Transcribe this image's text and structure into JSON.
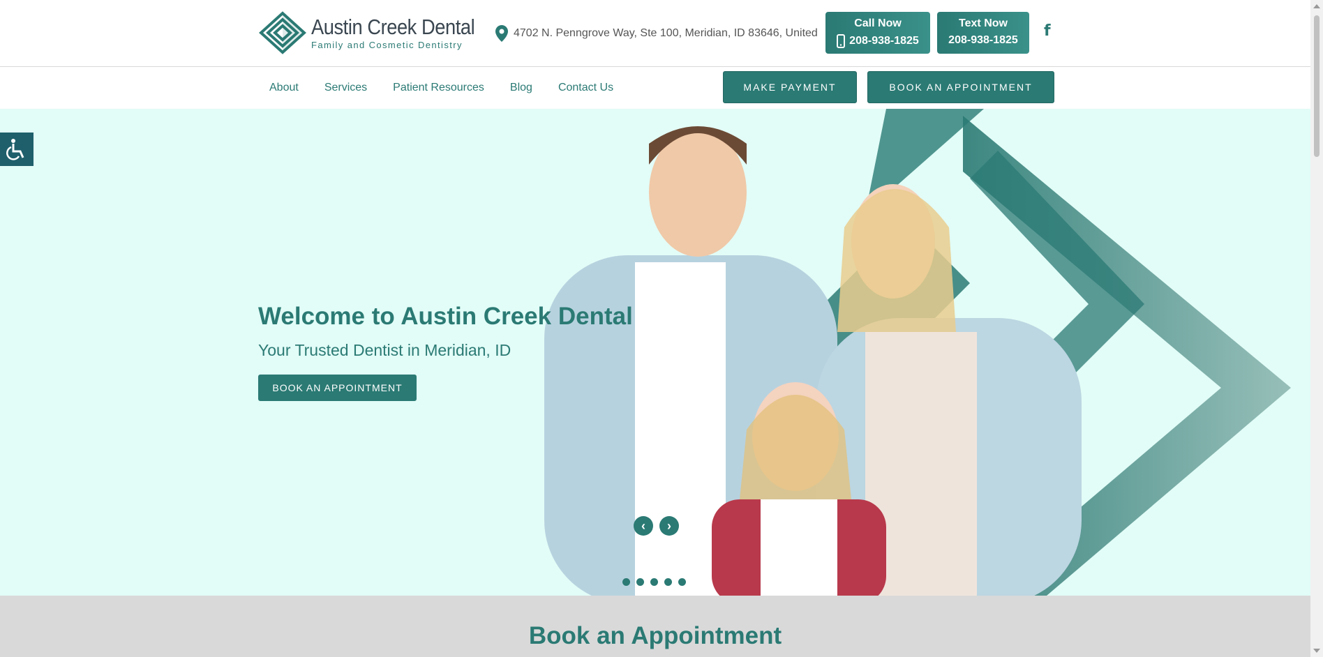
{
  "brand": {
    "name": "Austin Creek Dental",
    "tagline": "Family and Cosmetic Dentistry",
    "primary_color": "#2b7a74",
    "hero_bg": "#e2fcf7"
  },
  "header": {
    "address": "4702 N. Penngrove Way, Ste 100, Meridian, ID 83646, United",
    "call": {
      "label": "Call Now",
      "phone": "208-938-1825"
    },
    "text": {
      "label": "Text Now",
      "phone": "208-938-1825"
    },
    "social": "f"
  },
  "nav": {
    "items": [
      "About",
      "Services",
      "Patient Resources",
      "Blog",
      "Contact Us"
    ],
    "make_payment": "MAKE PAYMENT",
    "book": "BOOK AN APPOINTMENT"
  },
  "hero": {
    "title": "Welcome to Austin Creek Dental",
    "subtitle": "Your Trusted Dentist in Meridian, ID",
    "button": "BOOK AN APPOINTMENT",
    "prev": "‹",
    "next": "›",
    "slide_count": 5
  },
  "section": {
    "title": "Book an Appointment"
  },
  "icons": {
    "location": "map-pin-icon",
    "phone": "mobile-phone-icon",
    "facebook": "facebook-icon",
    "accessibility": "wheelchair-icon"
  }
}
